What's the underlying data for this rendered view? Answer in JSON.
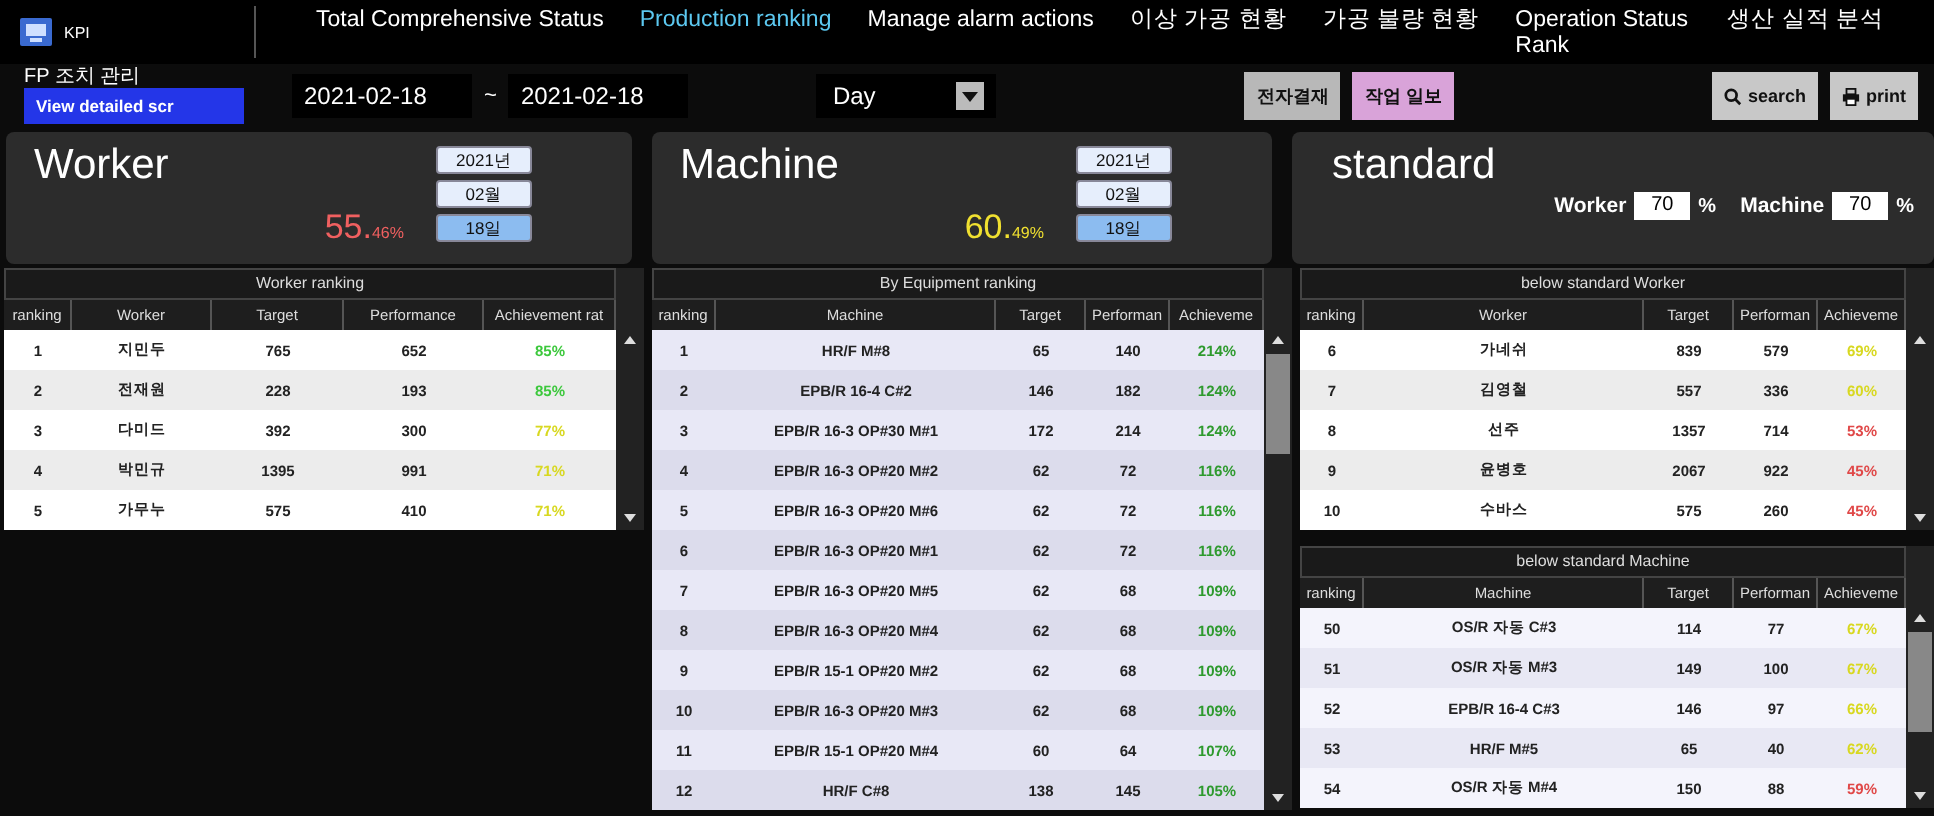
{
  "app": {
    "logo_label": "KPI"
  },
  "nav": [
    {
      "label": "Total Comprehensive Status",
      "selected": false
    },
    {
      "label": "Production ranking",
      "selected": true
    },
    {
      "label": "Manage alarm actions",
      "selected": false
    },
    {
      "label": "이상 가공 현황",
      "selected": false
    },
    {
      "label": "가공 불량 현황",
      "selected": false
    },
    {
      "label": "Operation Status Rank",
      "selected": false
    },
    {
      "label": "생산 실적 분석",
      "selected": false
    }
  ],
  "toolbar": {
    "section_label": "FP 조치 관리",
    "detail_button": "View detailed scr",
    "date_from": "2021-02-18",
    "date_separator": "~",
    "date_to": "2021-02-18",
    "period": "Day",
    "approval_button": "전자결재",
    "daily_report_button": "작업 일보",
    "search_button": "search",
    "print_button": "print"
  },
  "stats": [
    {
      "kind": "rate",
      "title": "Worker",
      "year": "2021년",
      "month": "02월",
      "day": "18일",
      "value": "55.",
      "fraction": "46%",
      "color": "#f06060"
    },
    {
      "kind": "rate",
      "title": "Machine",
      "year": "2021년",
      "month": "02월",
      "day": "18일",
      "value": "60.",
      "fraction": "49%",
      "color": "#f0e030"
    },
    {
      "kind": "standard",
      "title": "standard",
      "thresholds": [
        {
          "label": "Worker",
          "value": "70",
          "unit": "%"
        },
        {
          "label": "Machine",
          "value": "70",
          "unit": "%"
        }
      ]
    }
  ],
  "panels": [
    {
      "tables": [
        {
          "kind": "worker",
          "title": "Worker ranking",
          "columns": [
            "ranking",
            "Worker",
            "Target",
            "Performance",
            "Achievement rat"
          ],
          "rows": [
            {
              "cells": [
                "1",
                "지민두",
                "765",
                "652",
                "85%"
              ],
              "color": "#3cc83c"
            },
            {
              "cells": [
                "2",
                "전재원",
                "228",
                "193",
                "85%"
              ],
              "color": "#3cc83c"
            },
            {
              "cells": [
                "3",
                "다미드",
                "392",
                "300",
                "77%"
              ],
              "color": "#d8d820"
            },
            {
              "cells": [
                "4",
                "박민규",
                "1395",
                "991",
                "71%"
              ],
              "color": "#d8d820"
            },
            {
              "cells": [
                "5",
                "가무누",
                "575",
                "410",
                "71%"
              ],
              "color": "#d8d820"
            }
          ]
        }
      ]
    },
    {
      "tables": [
        {
          "kind": "machine",
          "title": "By Equipment ranking",
          "columns": [
            "ranking",
            "Machine",
            "Target",
            "Performan",
            "Achieveme"
          ],
          "rows": [
            {
              "cells": [
                "1",
                "HR/F M#8",
                "65",
                "140",
                "214%"
              ],
              "color": "#2e9a2e"
            },
            {
              "cells": [
                "2",
                "EPB/R 16-4 C#2",
                "146",
                "182",
                "124%"
              ],
              "color": "#2e9a2e"
            },
            {
              "cells": [
                "3",
                "EPB/R 16-3 OP#30 M#1",
                "172",
                "214",
                "124%"
              ],
              "color": "#2e9a2e"
            },
            {
              "cells": [
                "4",
                "EPB/R 16-3 OP#20 M#2",
                "62",
                "72",
                "116%"
              ],
              "color": "#2e9a2e"
            },
            {
              "cells": [
                "5",
                "EPB/R 16-3 OP#20 M#6",
                "62",
                "72",
                "116%"
              ],
              "color": "#2e9a2e"
            },
            {
              "cells": [
                "6",
                "EPB/R 16-3 OP#20 M#1",
                "62",
                "72",
                "116%"
              ],
              "color": "#2e9a2e"
            },
            {
              "cells": [
                "7",
                "EPB/R 16-3 OP#20 M#5",
                "62",
                "68",
                "109%"
              ],
              "color": "#2e9a2e"
            },
            {
              "cells": [
                "8",
                "EPB/R 16-3 OP#20 M#4",
                "62",
                "68",
                "109%"
              ],
              "color": "#2e9a2e"
            },
            {
              "cells": [
                "9",
                "EPB/R 15-1 OP#20 M#2",
                "62",
                "68",
                "109%"
              ],
              "color": "#2e9a2e"
            },
            {
              "cells": [
                "10",
                "EPB/R 16-3 OP#20 M#3",
                "62",
                "68",
                "109%"
              ],
              "color": "#2e9a2e"
            },
            {
              "cells": [
                "11",
                "EPB/R 15-1 OP#20 M#4",
                "60",
                "64",
                "107%"
              ],
              "color": "#2e9a2e"
            },
            {
              "cells": [
                "12",
                "HR/F C#8",
                "138",
                "145",
                "105%"
              ],
              "color": "#2e9a2e"
            }
          ]
        }
      ]
    },
    {
      "tables": [
        {
          "kind": "worker",
          "title": "below standard Worker",
          "columns": [
            "ranking",
            "Worker",
            "Target",
            "Performan",
            "Achieveme"
          ],
          "rows": [
            {
              "cells": [
                "6",
                "가네쉬",
                "839",
                "579",
                "69%"
              ],
              "color": "#d8d820"
            },
            {
              "cells": [
                "7",
                "김영철",
                "557",
                "336",
                "60%"
              ],
              "color": "#d8d820"
            },
            {
              "cells": [
                "8",
                "선주",
                "1357",
                "714",
                "53%"
              ],
              "color": "#e04848"
            },
            {
              "cells": [
                "9",
                "윤병호",
                "2067",
                "922",
                "45%"
              ],
              "color": "#e04848"
            },
            {
              "cells": [
                "10",
                "수바스",
                "575",
                "260",
                "45%"
              ],
              "color": "#e04848"
            }
          ]
        },
        {
          "kind": "machine",
          "title": "below standard Machine",
          "columns": [
            "ranking",
            "Machine",
            "Target",
            "Performan",
            "Achieveme"
          ],
          "rows": [
            {
              "cells": [
                "50",
                "OS/R 자동 C#3",
                "114",
                "77",
                "67%"
              ],
              "color": "#d8d820"
            },
            {
              "cells": [
                "51",
                "OS/R 자동 M#3",
                "149",
                "100",
                "67%"
              ],
              "color": "#d8d820"
            },
            {
              "cells": [
                "52",
                "EPB/R 16-4 C#3",
                "146",
                "97",
                "66%"
              ],
              "color": "#d8d820"
            },
            {
              "cells": [
                "53",
                "HR/F M#5",
                "65",
                "40",
                "62%"
              ],
              "color": "#d8d820"
            },
            {
              "cells": [
                "54",
                "OS/R 자동 M#4",
                "150",
                "88",
                "59%"
              ],
              "color": "#e04848"
            }
          ]
        }
      ]
    }
  ]
}
